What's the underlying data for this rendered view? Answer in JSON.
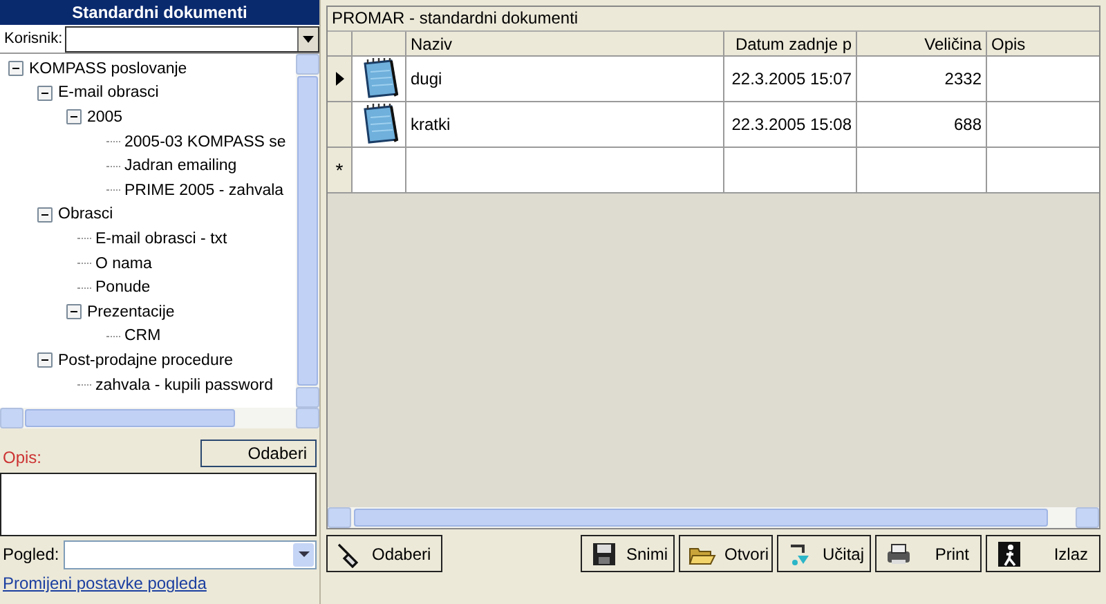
{
  "left_panel": {
    "title": "Standardni dokumenti",
    "user_label": "Korisnik:",
    "tree": [
      {
        "label": "KOMPASS poslovanje",
        "expanded": true,
        "children": [
          {
            "label": "E-mail obrasci",
            "expanded": true,
            "children": [
              {
                "label": "2005",
                "expanded": true,
                "children": [
                  {
                    "label": "2005-03 KOMPASS se"
                  },
                  {
                    "label": "Jadran emailing"
                  },
                  {
                    "label": "PRIME 2005 - zahvala"
                  }
                ]
              }
            ]
          },
          {
            "label": "Obrasci",
            "expanded": true,
            "children": [
              {
                "label": "E-mail obrasci - txt"
              },
              {
                "label": "O nama"
              },
              {
                "label": "Ponude"
              },
              {
                "label": "Prezentacije",
                "expanded": true,
                "children": [
                  {
                    "label": "CRM"
                  }
                ]
              }
            ]
          },
          {
            "label": "Post-prodajne procedure",
            "expanded": true,
            "children": [
              {
                "label": "zahvala - kupili password"
              }
            ]
          }
        ]
      }
    ],
    "select_button": "Odaberi",
    "description_label": "Opis:",
    "view_label": "Pogled:",
    "view_link": "Promijeni postavke pogleda"
  },
  "grid": {
    "title": "PROMAR - standardni dokumenti",
    "columns": [
      "Naziv",
      "Datum zadnje p",
      "Veličina",
      "Opis"
    ],
    "rows": [
      {
        "selected": true,
        "name": "dugi",
        "date": "22.3.2005 15:07",
        "size": "2332"
      },
      {
        "selected": false,
        "name": "kratki",
        "date": "22.3.2005 15:08",
        "size": "688"
      }
    ],
    "new_row_marker": "*"
  },
  "buttons": [
    {
      "kind": "select",
      "label": "Odaberi"
    },
    {
      "kind": "save",
      "label": "Snimi"
    },
    {
      "kind": "open",
      "label": "Otvori"
    },
    {
      "kind": "load",
      "label": "Učitaj"
    },
    {
      "kind": "print",
      "label": "Print"
    },
    {
      "kind": "exit",
      "label": "Izlaz"
    }
  ]
}
